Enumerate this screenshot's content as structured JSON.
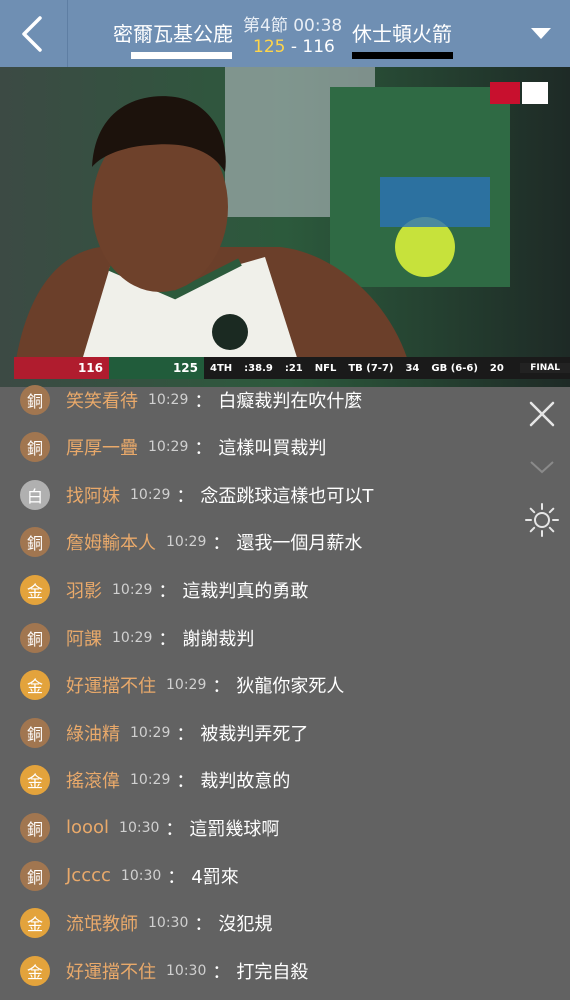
{
  "header": {
    "home_team": "密爾瓦基公鹿",
    "away_team": "休士頓火箭",
    "period": "第4節 00:38",
    "home_score": "125",
    "separator": " - ",
    "away_score": "116"
  },
  "scoreboard": {
    "team1_score": "116",
    "team2_score": "125",
    "quarter": "4TH",
    "clock": ":38.9",
    "shot_clock": ":21",
    "league": "NFL",
    "game1": "TB (7-7)",
    "game1_score": "34",
    "game2": "GB (6-6)",
    "game2_score": "20",
    "status": "FINAL"
  },
  "chat": [
    {
      "badge": "銅",
      "tier": "bronze",
      "user": "笑笑看待",
      "time": "10:29",
      "text": "白癡裁判在吹什麼"
    },
    {
      "badge": "銅",
      "tier": "bronze",
      "user": "厚厚一疊",
      "time": "10:29",
      "text": "這樣叫買裁判"
    },
    {
      "badge": "白",
      "tier": "white",
      "user": "找阿妹",
      "time": "10:29",
      "text": "念盃跳球這樣也可以T"
    },
    {
      "badge": "銅",
      "tier": "bronze",
      "user": "詹姆輸本人",
      "time": "10:29",
      "text": "還我一個月薪水"
    },
    {
      "badge": "金",
      "tier": "gold",
      "user": "羽影",
      "time": "10:29",
      "text": "這裁判真的勇敢"
    },
    {
      "badge": "銅",
      "tier": "bronze",
      "user": "阿課",
      "time": "10:29",
      "text": "謝謝裁判"
    },
    {
      "badge": "金",
      "tier": "gold",
      "user": "好運擋不住",
      "time": "10:29",
      "text": "狄龍你家死人"
    },
    {
      "badge": "銅",
      "tier": "bronze",
      "user": "綠油精",
      "time": "10:29",
      "text": "被裁判弄死了"
    },
    {
      "badge": "金",
      "tier": "gold",
      "user": "搖滾偉",
      "time": "10:29",
      "text": "裁判故意的"
    },
    {
      "badge": "銅",
      "tier": "bronze",
      "user": "loool",
      "time": "10:30",
      "text": "這罰幾球啊"
    },
    {
      "badge": "銅",
      "tier": "bronze",
      "user": "Jcccc",
      "time": "10:30",
      "text": "4罰來"
    },
    {
      "badge": "金",
      "tier": "gold",
      "user": "流氓教師",
      "time": "10:30",
      "text": "沒犯規"
    },
    {
      "badge": "金",
      "tier": "gold",
      "user": "好運擋不住",
      "time": "10:30",
      "text": "打完自殺"
    }
  ],
  "icons": {
    "back": "chevron-left-icon",
    "dropdown": "triangle-down-icon",
    "close": "close-icon",
    "collapse": "chevron-down-icon",
    "brightness": "sun-icon"
  },
  "colors": {
    "header_bg": "#6f8fb3",
    "chat_bg": "#626262",
    "username": "#e9a96a",
    "score_highlight": "#ffd54a"
  }
}
